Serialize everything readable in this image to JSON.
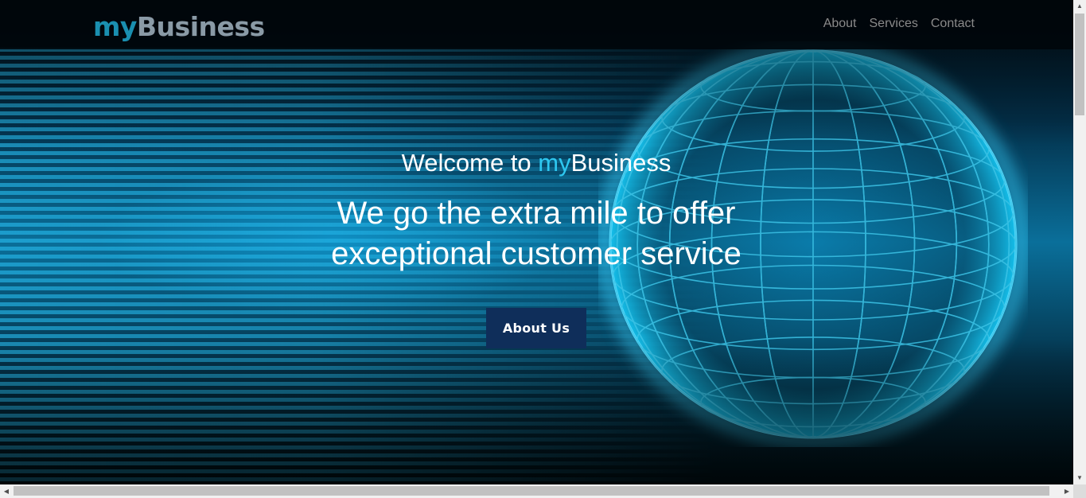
{
  "brand": {
    "my": "my",
    "business": "Business"
  },
  "nav": {
    "items": [
      "About",
      "Services",
      "Contact"
    ]
  },
  "hero": {
    "welcome_prefix": "Welcome to ",
    "welcome_my": "my",
    "welcome_business": "Business",
    "headline_line1": "We go the extra mile to offer",
    "headline_line2": "exceptional customer service",
    "button_label": "About Us"
  },
  "scrollbars": {
    "up": "▲",
    "down": "▼",
    "left": "◀",
    "right": "▶"
  },
  "colors": {
    "accent": "#2ec7f0",
    "button": "#0f2e5a",
    "logo_my": "#1a8fb0",
    "logo_business": "#8a9aa6"
  },
  "icons": {
    "background": "globe-illustration"
  }
}
